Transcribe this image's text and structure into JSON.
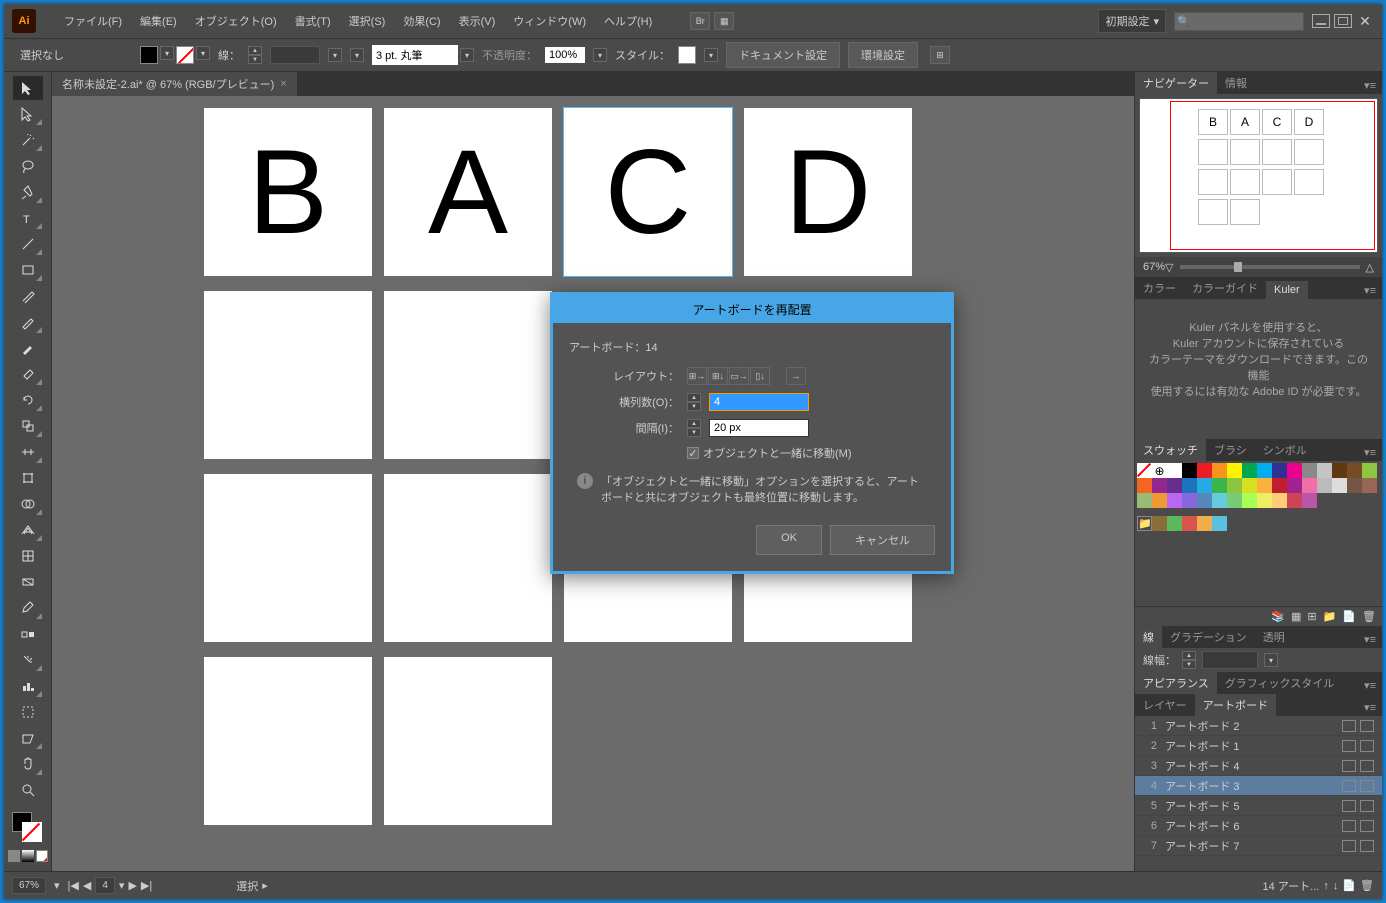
{
  "app": {
    "logo": "Ai"
  },
  "menu": [
    "ファイル(F)",
    "編集(E)",
    "オブジェクト(O)",
    "書式(T)",
    "選択(S)",
    "効果(C)",
    "表示(V)",
    "ウィンドウ(W)",
    "ヘルプ(H)"
  ],
  "workspace": "初期設定",
  "controlbar": {
    "selection": "選択なし",
    "stroke_label": "線：",
    "stroke_style": "3 pt. 丸筆",
    "opacity_label": "不透明度：",
    "opacity": "100%",
    "style_label": "スタイル：",
    "doc_setup": "ドキュメント設定",
    "prefs": "環境設定"
  },
  "doc_tab": "名称未設定-2.ai* @ 67% (RGB/プレビュー)",
  "letters": [
    "B",
    "A",
    "C",
    "D"
  ],
  "dialog": {
    "title": "アートボードを再配置",
    "count": "アートボード：14",
    "layout": "レイアウト：",
    "cols": "横列数(O)：",
    "cols_val": "4",
    "gap": "間隔(I)：",
    "gap_val": "20 px",
    "check": "オブジェクトと一緒に移動(M)",
    "info": "「オブジェクトと一緒に移動」オプションを選択すると、アートボードと共にオブジェクトも最終位置に移動します。",
    "ok": "OK",
    "cancel": "キャンセル"
  },
  "nav": {
    "tab1": "ナビゲーター",
    "tab2": "情報",
    "zoom": "67%"
  },
  "color": {
    "tab1": "カラー",
    "tab2": "カラーガイド",
    "tab3": "Kuler"
  },
  "kuler_msg": "Kuler パネルを使用すると、\nKuler アカウントに保存されている\nカラーテーマをダウンロードできます。この機能\n使用するには有効な Adobe ID が必要です。",
  "swatch": {
    "tab1": "スウォッチ",
    "tab2": "ブラシ",
    "tab3": "シンボル"
  },
  "sw_colors": [
    "#fff",
    "#000",
    "#ed1c24",
    "#f7941e",
    "#fff200",
    "#00a651",
    "#00aeef",
    "#2e3192",
    "#ec008c",
    "#898989",
    "#c4c4c4",
    "#603913",
    "#754c24",
    "#8dc63f",
    "#f26522",
    "#92278f",
    "#662d91",
    "#1c75bc",
    "#27aae1",
    "#39b54a",
    "#8cc63f",
    "#d7df23",
    "#fbb040",
    "#bf1e2e",
    "#a3238e",
    "#f06eaa",
    "#bbb",
    "#ddd",
    "#754",
    "#965",
    "#9b7",
    "#e93",
    "#b6e",
    "#86d",
    "#58b",
    "#6cd",
    "#7c7",
    "#af5",
    "#ee6",
    "#fc7",
    "#c45",
    "#b5a"
  ],
  "stroke": {
    "tab1": "線",
    "tab2": "グラデーション",
    "tab3": "透明",
    "width": "線幅："
  },
  "appear": {
    "tab1": "アピアランス",
    "tab2": "グラフィックスタイル"
  },
  "layer": {
    "tab1": "レイヤー",
    "tab2": "アートボード"
  },
  "artboards": [
    {
      "n": 1,
      "name": "アートボード 2"
    },
    {
      "n": 2,
      "name": "アートボード 1"
    },
    {
      "n": 3,
      "name": "アートボード 4"
    },
    {
      "n": 4,
      "name": "アートボード 3"
    },
    {
      "n": 5,
      "name": "アートボード 5"
    },
    {
      "n": 6,
      "name": "アートボード 6"
    },
    {
      "n": 7,
      "name": "アートボード 7"
    }
  ],
  "status": {
    "zoom": "67%",
    "ab": "4",
    "sel": "選択",
    "side": "14 アート..."
  }
}
